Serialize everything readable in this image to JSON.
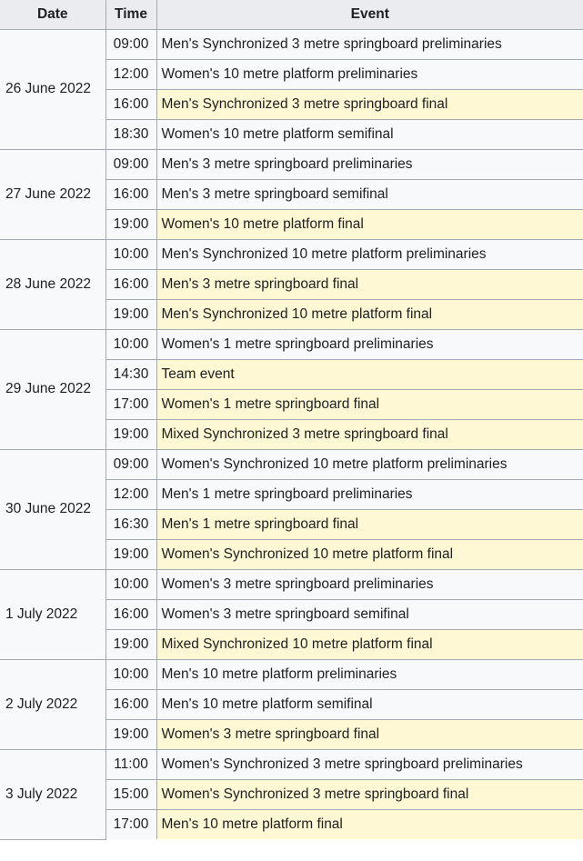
{
  "header": {
    "date": "Date",
    "time": "Time",
    "event": "Event"
  },
  "days": [
    {
      "date": "26 June 2022",
      "events": [
        {
          "time": "09:00",
          "event": "Men's Synchronized 3 metre springboard preliminaries",
          "final": false
        },
        {
          "time": "12:00",
          "event": "Women's 10 metre platform preliminaries",
          "final": false
        },
        {
          "time": "16:00",
          "event": "Men's Synchronized 3 metre springboard final",
          "final": true
        },
        {
          "time": "18:30",
          "event": "Women's 10 metre platform semifinal",
          "final": false
        }
      ]
    },
    {
      "date": "27 June 2022",
      "events": [
        {
          "time": "09:00",
          "event": "Men's 3 metre springboard preliminaries",
          "final": false
        },
        {
          "time": "16:00",
          "event": "Men's 3 metre springboard semifinal",
          "final": false
        },
        {
          "time": "19:00",
          "event": "Women's 10 metre platform final",
          "final": true
        }
      ]
    },
    {
      "date": "28 June 2022",
      "events": [
        {
          "time": "10:00",
          "event": "Men's Synchronized 10 metre platform preliminaries",
          "final": false
        },
        {
          "time": "16:00",
          "event": "Men's 3 metre springboard final",
          "final": true
        },
        {
          "time": "19:00",
          "event": "Men's Synchronized 10 metre platform final",
          "final": true
        }
      ]
    },
    {
      "date": "29 June 2022",
      "events": [
        {
          "time": "10:00",
          "event": "Women's 1 metre springboard preliminaries",
          "final": false
        },
        {
          "time": "14:30",
          "event": "Team event",
          "final": true
        },
        {
          "time": "17:00",
          "event": "Women's 1 metre springboard final",
          "final": true
        },
        {
          "time": "19:00",
          "event": "Mixed Synchronized 3 metre springboard final",
          "final": true
        }
      ]
    },
    {
      "date": "30 June 2022",
      "events": [
        {
          "time": "09:00",
          "event": "Women's Synchronized 10 metre platform preliminaries",
          "final": false
        },
        {
          "time": "12:00",
          "event": "Men's 1 metre springboard preliminaries",
          "final": false
        },
        {
          "time": "16:30",
          "event": "Men's 1 metre springboard final",
          "final": true
        },
        {
          "time": "19:00",
          "event": "Women's Synchronized 10 metre platform final",
          "final": true
        }
      ]
    },
    {
      "date": "1 July 2022",
      "events": [
        {
          "time": "10:00",
          "event": "Women's 3 metre springboard preliminaries",
          "final": false
        },
        {
          "time": "16:00",
          "event": "Women's 3 metre springboard semifinal",
          "final": false
        },
        {
          "time": "19:00",
          "event": "Mixed Synchronized 10 metre platform final",
          "final": true
        }
      ]
    },
    {
      "date": "2 July 2022",
      "events": [
        {
          "time": "10:00",
          "event": "Men's 10 metre platform preliminaries",
          "final": false
        },
        {
          "time": "16:00",
          "event": "Men's 10 metre platform semifinal",
          "final": false
        },
        {
          "time": "19:00",
          "event": "Women's 3 metre springboard final",
          "final": true
        }
      ]
    },
    {
      "date": "3 July 2022",
      "events": [
        {
          "time": "11:00",
          "event": "Women's Synchronized 3 metre springboard preliminaries",
          "final": false
        },
        {
          "time": "15:00",
          "event": "Women's Synchronized 3 metre springboard final",
          "final": true
        },
        {
          "time": "17:00",
          "event": "Men's 10 metre platform final",
          "final": true
        }
      ]
    }
  ],
  "colors": {
    "header_bg": "#eaecf0",
    "cell_bg": "#f8f9fa",
    "final_bg": "#fff8d4",
    "border": "#a2a9b1"
  }
}
